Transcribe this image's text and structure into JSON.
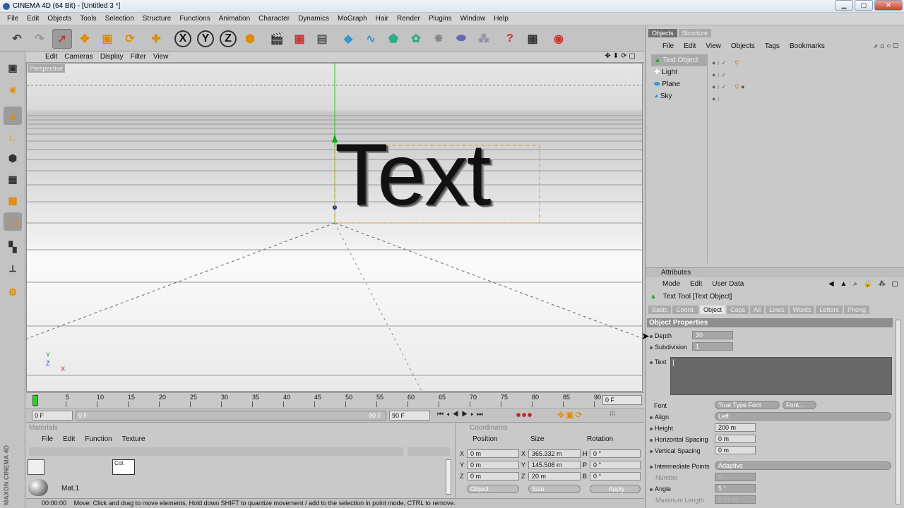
{
  "window": {
    "title": "CINEMA 4D (64 Bit) - [Untitled 3 *]",
    "buttons": [
      "0",
      "1",
      "r"
    ]
  },
  "menubar": [
    "File",
    "Edit",
    "Objects",
    "Tools",
    "Selection",
    "Structure",
    "Functions",
    "Animation",
    "Character",
    "Dynamics",
    "MoGraph",
    "Hair",
    "Render",
    "Plugins",
    "Window",
    "Help"
  ],
  "viewport": {
    "menu": [
      "Edit",
      "Cameras",
      "Display",
      "Filter",
      "View"
    ],
    "label": "Perspective",
    "text_object": "Text",
    "axis_y": "Y",
    "axis_z": "Z",
    "axis_x": "X"
  },
  "timeline": {
    "ticks": [
      "0",
      "5",
      "10",
      "15",
      "20",
      "25",
      "30",
      "35",
      "40",
      "45",
      "50",
      "55",
      "60",
      "65",
      "70",
      "75",
      "80",
      "85",
      "90"
    ],
    "current_frame": "0 F",
    "start_field": "0 F",
    "range_start": "0 F",
    "range_end": "90 F",
    "end_field": "90 F"
  },
  "materials": {
    "title": "Materials",
    "menu": [
      "File",
      "Edit",
      "Function",
      "Texture"
    ],
    "items": [
      {
        "name": "Mat.1"
      }
    ],
    "thumb_label": "Col."
  },
  "coords": {
    "title": "Coordinates",
    "col_position": "Position",
    "col_size": "Size",
    "col_rotation": "Rotation",
    "rows": [
      {
        "axis": "X",
        "pos": "0 m",
        "size_axis": "X",
        "size": "365.332 m",
        "rot_axis": "H",
        "rot": "0 °"
      },
      {
        "axis": "Y",
        "pos": "0 m",
        "size_axis": "Y",
        "size": "145.508 m",
        "rot_axis": "P",
        "rot": "0 °"
      },
      {
        "axis": "Z",
        "pos": "0 m",
        "size_axis": "Z",
        "size": "20 m",
        "rot_axis": "B",
        "rot": "0 °"
      }
    ],
    "mode_select": "Object",
    "size_select": "Size",
    "apply": "Apply"
  },
  "status": {
    "time": "00:00:00",
    "message": "Move: Click and drag to move elements. Hold down SHIFT to quantize movement / add to the selection in point mode, CTRL to remove."
  },
  "objects_panel": {
    "tabs": [
      "Objects",
      "Structure"
    ],
    "menu": [
      "File",
      "Edit",
      "View",
      "Objects",
      "Tags",
      "Bookmarks"
    ],
    "items": [
      {
        "name": "Text Object",
        "selected": true
      },
      {
        "name": "Light",
        "selected": false
      },
      {
        "name": "Plane",
        "selected": false
      },
      {
        "name": "Sky",
        "selected": false
      }
    ]
  },
  "attributes": {
    "title": "Attributes",
    "menu": [
      "Mode",
      "Edit",
      "User Data"
    ],
    "object_title": "Text Tool [Text Object]",
    "tabs": [
      "Basic",
      "Coord.",
      "Object",
      "Caps",
      "All",
      "Lines",
      "Words",
      "Letters",
      "Phong"
    ],
    "active_tab": "Object",
    "section": "Object Properties",
    "depth_label": "Depth",
    "depth": "20",
    "subdivision_label": "Subdivision",
    "subdivision": "1",
    "text_label": "Text",
    "text_value": "|",
    "font_label": "Font",
    "font_value": "True Type Font",
    "font_button": "Font...",
    "align_label": "Align",
    "align_value": "Left",
    "height_label": "Height",
    "height_value": "200 m",
    "hspacing_label": "Horizontal Spacing",
    "hspacing_value": "0 m",
    "vspacing_label": "Vertical Spacing",
    "vspacing_value": "0 m",
    "intpoints_label": "Intermediate Points",
    "intpoints_value": "Adaptive",
    "number_label": "Number",
    "number_value": "8",
    "angle_label": "Angle",
    "angle_value": "5 °",
    "maxlength_label": "Maximum Length",
    "maxlength_value": "0.01 m"
  },
  "brand": "MAXON CINEMA 4D"
}
